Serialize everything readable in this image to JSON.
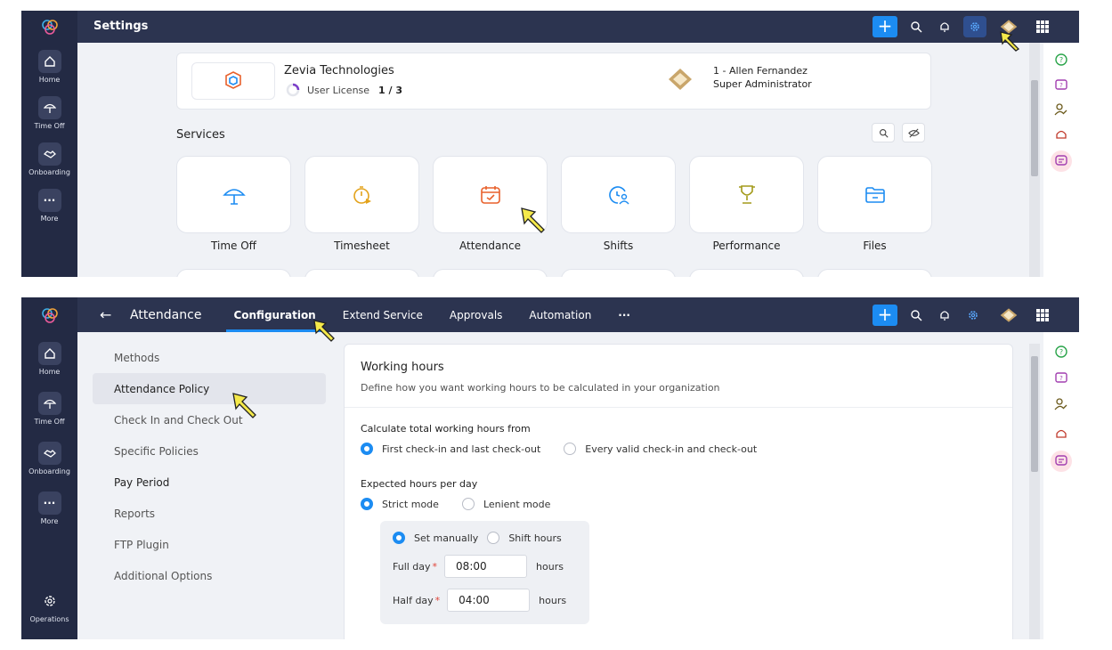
{
  "panel1": {
    "header_title": "Settings",
    "org": {
      "name": "Zevia Technologies",
      "license_label": "User License",
      "license_count": "1 / 3"
    },
    "admin": {
      "line1": "1 - Allen Fernandez",
      "line2": "Super Administrator"
    },
    "services_label": "Services",
    "services": [
      {
        "label": "Time Off",
        "icon": "umbrella-icon",
        "color": "#1c8cf2"
      },
      {
        "label": "Timesheet",
        "icon": "timer-icon",
        "color": "#e3a21a"
      },
      {
        "label": "Attendance",
        "icon": "calendar-check-icon",
        "color": "#e8612c"
      },
      {
        "label": "Shifts",
        "icon": "clock-user-icon",
        "color": "#1c8cf2"
      },
      {
        "label": "Performance",
        "icon": "trophy-icon",
        "color": "#a39a1a"
      },
      {
        "label": "Files",
        "icon": "folder-icon",
        "color": "#1c8cf2"
      }
    ]
  },
  "rail": {
    "items": [
      {
        "label": "Home",
        "icon": "home-icon"
      },
      {
        "label": "Time Off",
        "icon": "umbrella-icon"
      },
      {
        "label": "Onboarding",
        "icon": "handshake-icon"
      },
      {
        "label": "More",
        "icon": "more-dots-icon"
      }
    ],
    "operations_label": "Operations"
  },
  "panel2": {
    "app_title": "Attendance",
    "tabs": [
      "Configuration",
      "Extend Service",
      "Approvals",
      "Automation",
      "···"
    ],
    "menu": [
      "Methods",
      "Attendance Policy",
      "Check In and Check Out",
      "Specific Policies",
      "Pay Period",
      "Reports",
      "FTP Plugin",
      "Additional Options"
    ],
    "form": {
      "title": "Working hours",
      "description": "Define how you want working hours to be calculated in your organization",
      "calc_label": "Calculate total working hours from",
      "calc_opt1": "First check-in and last check-out",
      "calc_opt2": "Every valid check-in and check-out",
      "expected_label": "Expected hours per day",
      "mode1": "Strict mode",
      "mode2": "Lenient mode",
      "set_manually": "Set manually",
      "shift_hours": "Shift hours",
      "full_day_label": "Full day",
      "full_day_value": "08:00",
      "half_day_label": "Half day",
      "half_day_value": "04:00",
      "hours_unit": "hours",
      "required_mark": "*"
    }
  },
  "colors": {
    "topbar": "#2c3450",
    "rail": "#232a44",
    "accent": "#1c8cf2",
    "cursor": "#f5e94a"
  }
}
